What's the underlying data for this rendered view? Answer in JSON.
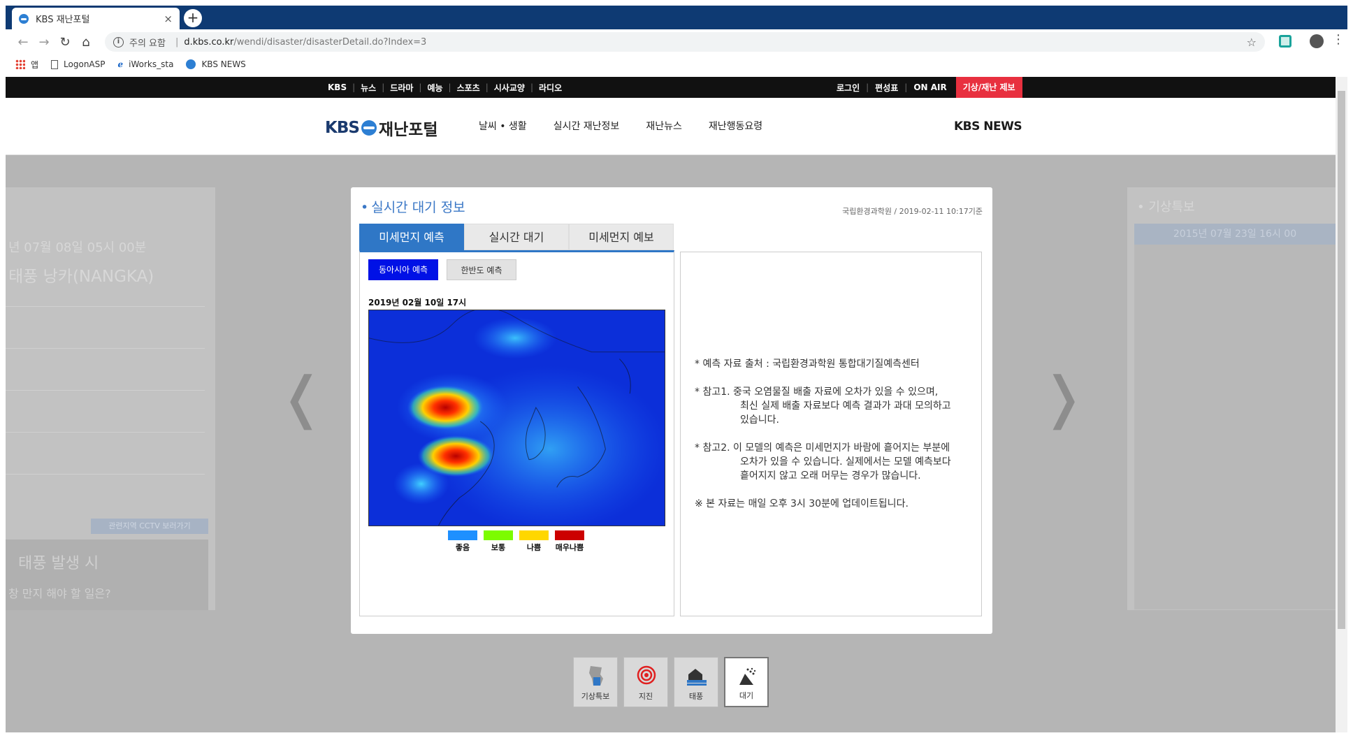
{
  "browser": {
    "tab_title": "KBS 재난포털",
    "tab_close": "×",
    "new_tab": "+",
    "security_label": "주의 요함",
    "url_host": "d.kbs.co.kr",
    "url_path": "/wendi/disaster/disasterDetail.do?Index=3",
    "bookmarks": [
      {
        "label": "앱",
        "icon": "apps-grid-icon"
      },
      {
        "label": "LogonASP",
        "icon": "document-icon"
      },
      {
        "label": "iWorks_sta",
        "icon": "ie-icon"
      },
      {
        "label": "KBS NEWS",
        "icon": "kbs-icon"
      }
    ]
  },
  "gnb": {
    "left_items": [
      "KBS",
      "뉴스",
      "드라마",
      "예능",
      "스포츠",
      "시사교양",
      "라디오"
    ],
    "right_items": [
      "로그인",
      "편성표",
      "ON AIR"
    ],
    "report_label": "기상/재난 제보"
  },
  "header": {
    "logo_kbs": "KBS",
    "logo_portal": "재난포털",
    "menu": [
      "날씨 • 생활",
      "실시간 재난정보",
      "재난뉴스",
      "재난행동요령"
    ],
    "kbs_news": "KBS NEWS"
  },
  "background": {
    "left_date": "년 07월 08일 05시 00분",
    "left_title": "태풍 낭카(NANGKA)",
    "left_cctv": "관련지역 CCTV 보러가기",
    "left_photo_title": "태풍 발생 시",
    "left_photo_sub": "창 만지 해야 할 일은?",
    "right_title": "• 기상특보",
    "right_date": "2015년 07월 23일 16시 00"
  },
  "card": {
    "title": "실시간 대기 정보",
    "source": "국립환경과학원 / 2019-02-11 10:17기준",
    "tabs": [
      "미세먼지 예측",
      "실시간 대기",
      "미세먼지 예보"
    ],
    "active_tab": 0,
    "sub_buttons": [
      "동아시아 예측",
      "한반도 예측"
    ],
    "map_date": "2019년 02월 10일 17시",
    "legend": [
      {
        "label": "좋음",
        "color": "#1e90ff"
      },
      {
        "label": "보통",
        "color": "#7cfc00"
      },
      {
        "label": "나쁨",
        "color": "#ffd700"
      },
      {
        "label": "매우나쁨",
        "color": "#cc0000"
      }
    ],
    "notes": [
      "* 예측 자료 출처 : 국립환경과학원 통합대기질예측센터",
      "* 참고1. 중국 오염물질 배출 자료에 오차가 있을 수 있으며,",
      "최신 실제 배출 자료보다 예측 결과가 과대 모의하고",
      "있습니다.",
      "* 참고2. 이 모델의 예측은 미세먼지가 바람에 흩어지는 부분에",
      "오차가 있을 수 있습니다. 실제에서는 모델 예측보다",
      "흩어지지 않고 오래 머무는 경우가 많습니다.",
      "※ 본 자료는 매일 오후 3시 30분에 업데이트됩니다."
    ]
  },
  "nav": {
    "prev": "❬",
    "next": "❭"
  },
  "categories": [
    {
      "label": "기상특보",
      "icon": "korea-map-icon"
    },
    {
      "label": "지진",
      "icon": "earthquake-target-icon"
    },
    {
      "label": "태풍",
      "icon": "flood-house-icon"
    },
    {
      "label": "대기",
      "icon": "dust-icon"
    }
  ]
}
